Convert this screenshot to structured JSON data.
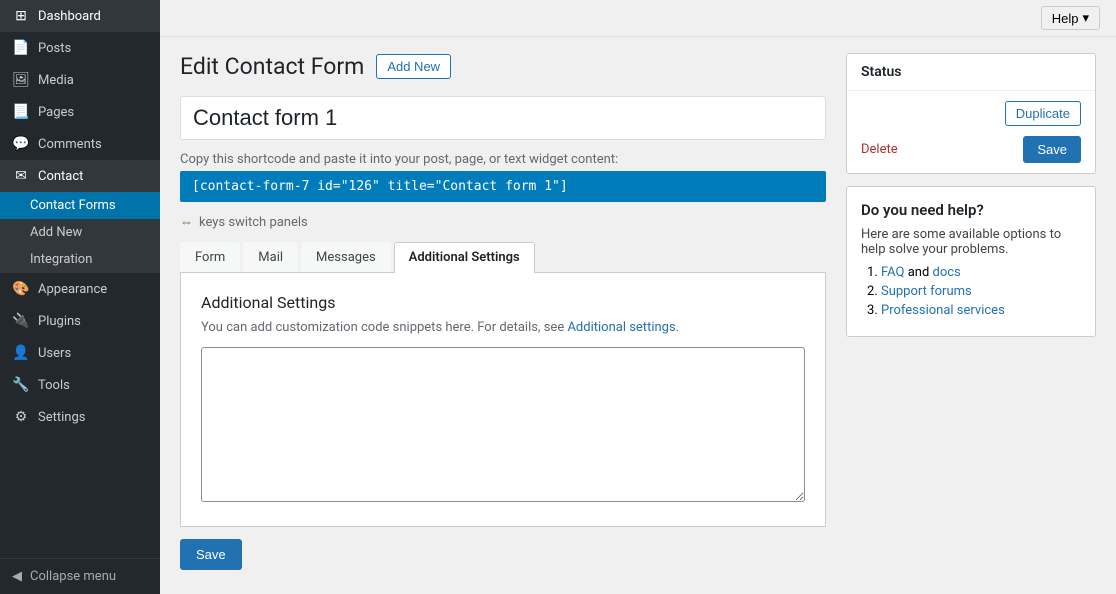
{
  "sidebar": {
    "items": [
      {
        "id": "dashboard",
        "label": "Dashboard",
        "icon": "⊞"
      },
      {
        "id": "posts",
        "label": "Posts",
        "icon": "📄"
      },
      {
        "id": "media",
        "label": "Media",
        "icon": "🖼"
      },
      {
        "id": "pages",
        "label": "Pages",
        "icon": "📃"
      },
      {
        "id": "comments",
        "label": "Comments",
        "icon": "💬"
      },
      {
        "id": "contact",
        "label": "Contact",
        "icon": "✉",
        "active_parent": true
      }
    ],
    "submenu": [
      {
        "id": "contact-forms",
        "label": "Contact Forms",
        "active": true
      },
      {
        "id": "add-new",
        "label": "Add New"
      },
      {
        "id": "integration",
        "label": "Integration"
      }
    ],
    "bottom_items": [
      {
        "id": "appearance",
        "label": "Appearance",
        "icon": "🎨"
      },
      {
        "id": "plugins",
        "label": "Plugins",
        "icon": "🔌"
      },
      {
        "id": "users",
        "label": "Users",
        "icon": "👤"
      },
      {
        "id": "tools",
        "label": "Tools",
        "icon": "🔧"
      },
      {
        "id": "settings",
        "label": "Settings",
        "icon": "⚙"
      }
    ],
    "collapse_label": "Collapse menu"
  },
  "topbar": {
    "help_label": "Help",
    "help_arrow": "▾"
  },
  "page": {
    "title": "Edit Contact Form",
    "add_new_label": "Add New",
    "form_title_value": "Contact form 1",
    "form_title_placeholder": "Contact form 1",
    "shortcode_label": "Copy this shortcode and paste it into your post, page, or text widget content:",
    "shortcode_value": "[contact-form-7 id=\"126\" title=\"Contact form 1\"]",
    "keys_hint": "⇔ keys switch panels"
  },
  "tabs": [
    {
      "id": "form",
      "label": "Form"
    },
    {
      "id": "mail",
      "label": "Mail"
    },
    {
      "id": "messages",
      "label": "Messages"
    },
    {
      "id": "additional-settings",
      "label": "Additional Settings",
      "active": true
    }
  ],
  "additional_settings": {
    "section_title": "Additional Settings",
    "section_desc_prefix": "You can add customization code snippets here. For details, see ",
    "section_desc_link": "Additional settings",
    "section_desc_suffix": ".",
    "section_desc_link_url": "#",
    "textarea_placeholder": ""
  },
  "bottom_save": {
    "label": "Save"
  },
  "status_panel": {
    "title": "Status",
    "duplicate_label": "Duplicate",
    "delete_label": "Delete",
    "save_label": "Save"
  },
  "help_panel": {
    "title": "Do you need help?",
    "description": "Here are some available options to help solve your problems.",
    "items": [
      {
        "id": "faq",
        "parts": [
          {
            "text": "FAQ",
            "link": true,
            "url": "#"
          },
          {
            "text": " and ",
            "link": false
          },
          {
            "text": "docs",
            "link": true,
            "url": "#"
          }
        ]
      },
      {
        "id": "support",
        "parts": [
          {
            "text": "Support forums",
            "link": true,
            "url": "#"
          }
        ]
      },
      {
        "id": "professional",
        "parts": [
          {
            "text": "Professional services",
            "link": true,
            "url": "#"
          }
        ]
      }
    ]
  }
}
